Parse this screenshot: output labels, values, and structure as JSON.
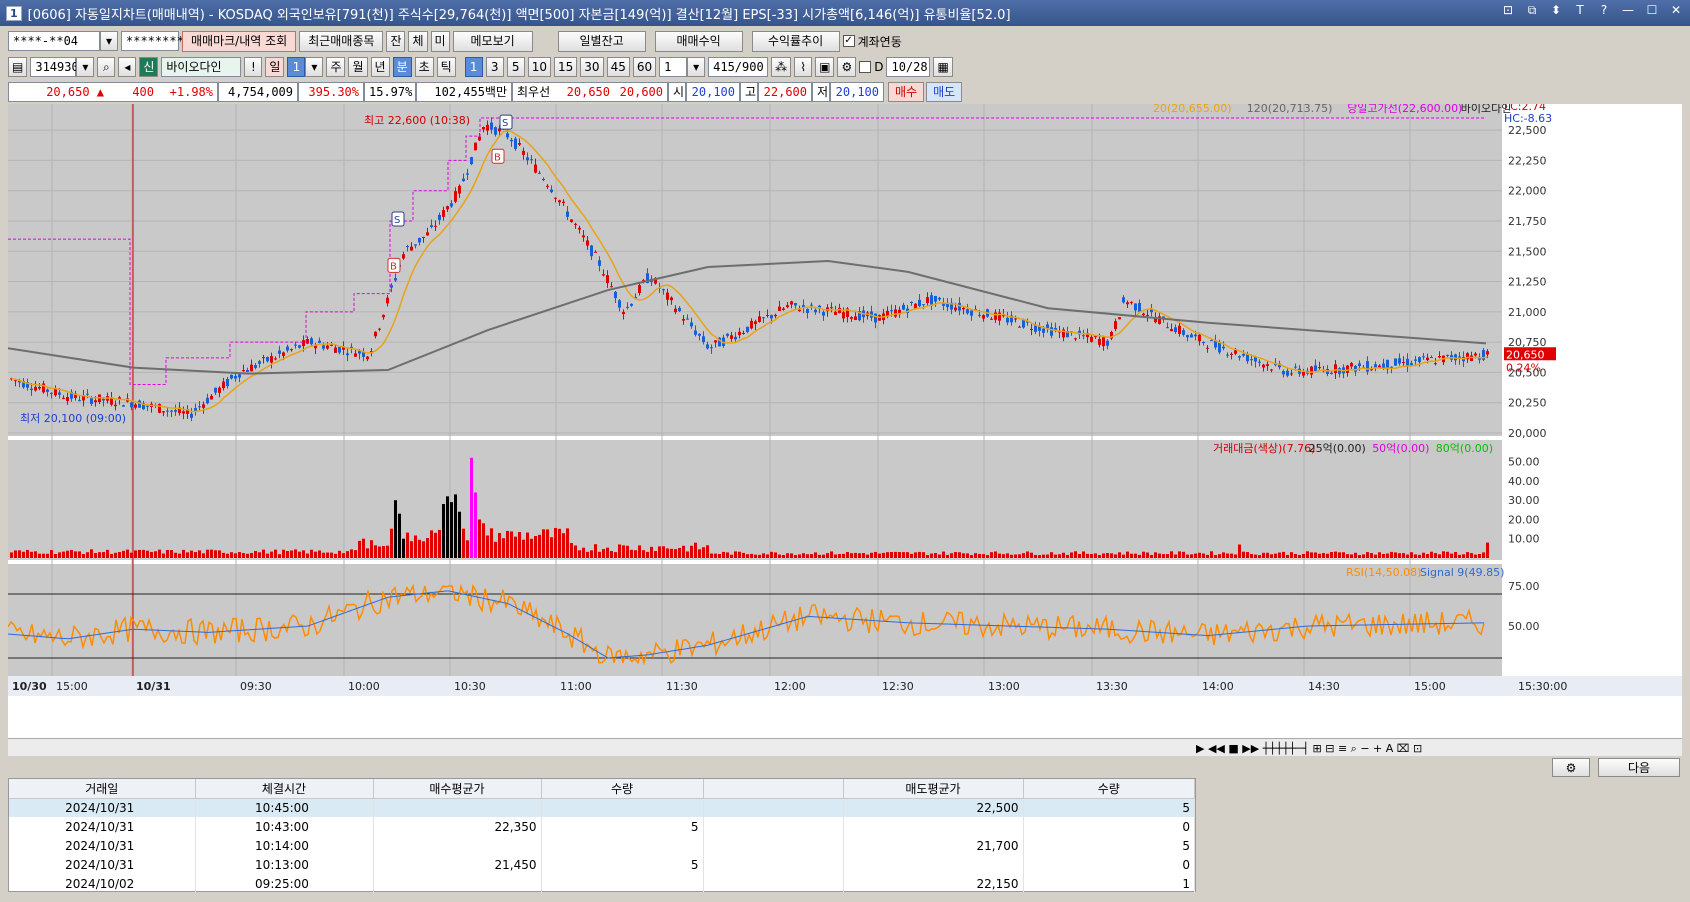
{
  "window": {
    "num": "1",
    "title": "[0606] 자동일지차트(매매내역) - KOSDAQ 외국인보유[791(천)] 주식수[29,764(천)] 액면[500] 자본금[149(억)] 결산[12월] EPS[-33] 시가총액[6,146(억)] 유통비율[52.0]",
    "controls": [
      "⊡",
      "⧉",
      "⬍",
      "T",
      "?",
      "—",
      "☐",
      "✕"
    ]
  },
  "toolbar1": {
    "account": "****-**04",
    "password": "********",
    "buttons": [
      "매매마크/내역 조회",
      "최근매매종목",
      "잔",
      "체",
      "미",
      "메모보기",
      "일별잔고",
      "매매수익",
      "수익률추이"
    ],
    "link_label": "계좌연동",
    "link_checked": "✓"
  },
  "toolbar2": {
    "code": "314930",
    "credit": "신",
    "name": "바이오다인",
    "excl": "!",
    "period": [
      "일",
      "주",
      "월",
      "년",
      "분",
      "초",
      "틱"
    ],
    "period_sel": "1",
    "minutes": [
      "1",
      "3",
      "5",
      "10",
      "15",
      "30",
      "45",
      "60"
    ],
    "count": "1",
    "range": "415/900",
    "date": "10/28",
    "d_label": "D"
  },
  "quote": {
    "price": "20,650 ▲",
    "change": "400",
    "pct": "+1.98%",
    "volume": "4,754,009",
    "vol_ratio": "395.30%",
    "turnover": "15.97%",
    "amount": "102,455백만",
    "best_label": "최우선",
    "ask": "20,650",
    "bid": "20,600",
    "open_label": "시",
    "open": "20,100",
    "high_label": "고",
    "high": "22,600",
    "low_label": "저",
    "low": "20,100",
    "buy": "매수",
    "sell": "매도"
  },
  "chart_data": [
    {
      "type": "candlestick",
      "title": "",
      "legend": [
        "20(20,655.00)",
        "120(20,713.75)",
        "당일고가선(22,600.00)",
        "바이오다인"
      ],
      "right_labels": {
        "lc": "LC:2.74",
        "hc": "HC:-8.63",
        "price": "20,650",
        "pct": "0.24%"
      },
      "ylim": [
        20000,
        22600
      ],
      "yticks": [
        "22,500",
        "22,250",
        "22,000",
        "21,750",
        "21,500",
        "21,250",
        "21,000",
        "20,750",
        "20,500",
        "20,250",
        "20,000"
      ],
      "annotations": [
        "최고 22,600 (10:38)",
        "최저 20,100 (09:00)"
      ],
      "trade_marks": [
        {
          "time": "10:13",
          "side": "B",
          "price": 21450
        },
        {
          "time": "10:14",
          "side": "S",
          "price": 21700
        },
        {
          "time": "10:43",
          "side": "B",
          "price": 22350
        },
        {
          "time": "10:45",
          "side": "S",
          "price": 22500
        }
      ]
    },
    {
      "type": "bar",
      "title": "",
      "legend": [
        "거래대금(색상)(7.76)",
        "25억(0.00)",
        "50억(0.00)",
        "80억(0.00)"
      ],
      "ylim": [
        0,
        55
      ],
      "yticks": [
        "50.00",
        "40.00",
        "30.00",
        "20.00",
        "10.00"
      ]
    },
    {
      "type": "line",
      "title": "",
      "legend": [
        "RSI(14,50.08)",
        "Signal 9(49.85)"
      ],
      "ylim": [
        20,
        85
      ],
      "yticks": [
        "75.00",
        "50.00"
      ]
    }
  ],
  "xaxis": {
    "labels": [
      "10/30",
      "15:00",
      "10/31",
      "09:30",
      "10:00",
      "10:30",
      "11:00",
      "11:30",
      "12:00",
      "12:30",
      "13:00",
      "13:30",
      "14:00",
      "14:30",
      "15:00",
      "15:30:00"
    ]
  },
  "colors": {
    "up": "#e00000",
    "down": "#1560d8",
    "ma20": "#e8a317",
    "ma120": "#6e6e6e",
    "highline": "#e000e0",
    "rsi": "#ff8c00",
    "signal": "#2f6ad9"
  },
  "grid": {
    "headers": [
      "거래일",
      "체결시간",
      "매수평균가",
      "수량",
      "",
      "매도평균가",
      "수량"
    ],
    "rows": [
      [
        "2024/10/31",
        "10:45:00",
        "",
        "",
        "",
        "22,500",
        "5"
      ],
      [
        "2024/10/31",
        "10:43:00",
        "22,350",
        "5",
        "",
        "",
        "0"
      ],
      [
        "2024/10/31",
        "10:14:00",
        "",
        "",
        "",
        "21,700",
        "5"
      ],
      [
        "2024/10/31",
        "10:13:00",
        "21,450",
        "5",
        "",
        "",
        "0"
      ],
      [
        "2024/10/02",
        "09:25:00",
        "",
        "",
        "",
        "22,150",
        "1"
      ]
    ]
  },
  "buttons": {
    "next": "다음"
  }
}
